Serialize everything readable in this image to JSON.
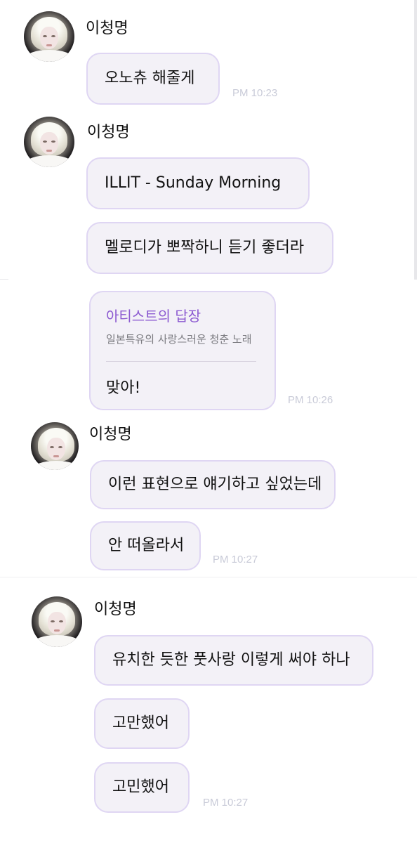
{
  "chat": {
    "sender_name": "이청명",
    "groups": [
      {
        "messages": [
          "오노츄 해줄게"
        ],
        "time": "PM 10:23"
      },
      {
        "messages": [
          "ILLIT - Sunday Morning",
          "멜로디가 뽀짝하니 듣기 좋더라"
        ]
      },
      {
        "reply": {
          "label": "아티스트의 답장",
          "quoted": "일본특유의 사랑스러운 청춘 노래",
          "message": "맞아!"
        },
        "time": "PM 10:26"
      },
      {
        "messages": [
          "이런 표현으로 얘기하고 싶었는데",
          "안 떠올라서"
        ],
        "time": "PM 10:27"
      },
      {
        "messages": [
          "유치한 듯한 풋사랑 이렇게 써야 하나",
          "고만했어",
          "고민했어"
        ],
        "time": "PM 10:27"
      }
    ]
  }
}
